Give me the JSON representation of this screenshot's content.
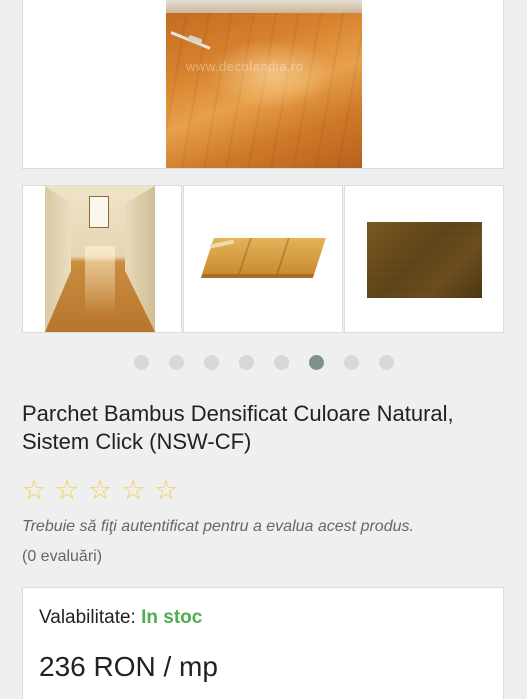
{
  "gallery": {
    "watermark": "www.decolandia.ro",
    "dots_total": 8,
    "active_dot_index": 5
  },
  "product": {
    "title": "Parchet Bambus Densificat Culoare Natural, Sistem Click (NSW-CF)",
    "rating": {
      "stars": [
        "☆",
        "☆",
        "☆",
        "☆",
        "☆"
      ],
      "value": 0,
      "login_note": "Trebuie să fiţi autentificat pentru a evalua acest produs.",
      "count_text": "(0 evaluări)"
    },
    "availability_label": "Valabilitate: ",
    "availability_value": "In stoc",
    "price": "236 RON / mp"
  },
  "colors": {
    "background": "#efefef",
    "star": "#f2cf4e",
    "in_stock": "#4caf50",
    "active_dot": "#7f918c",
    "inactive_dot": "#d8d8d8"
  }
}
